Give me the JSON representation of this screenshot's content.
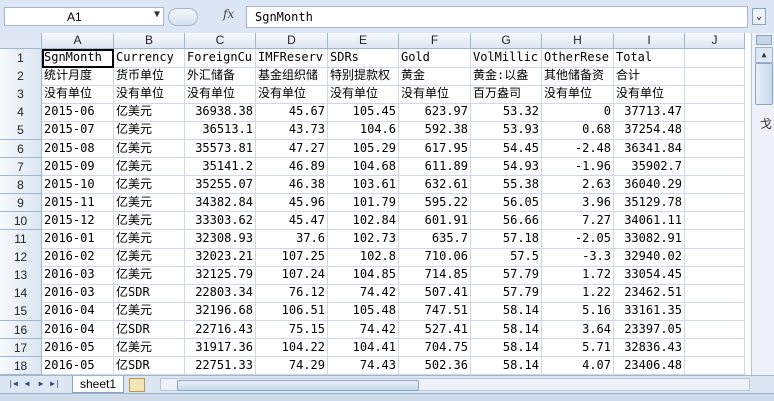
{
  "formula_bar": {
    "name_box": "A1",
    "fx_label": "fx",
    "formula_value": "SgnMonth"
  },
  "columns": [
    "A",
    "B",
    "C",
    "D",
    "E",
    "F",
    "G",
    "H",
    "I",
    "J"
  ],
  "rows": [
    [
      "SgnMonth",
      "Currency",
      "ForeignCu",
      "IMFReserv",
      "SDRs",
      "Gold",
      "VolMillic",
      "OtherRese",
      "Total",
      ""
    ],
    [
      "统计月度",
      "货币单位",
      "外汇储备",
      "基金组织储",
      "特别提款权",
      "黄金",
      "黄金:以盎",
      "其他储备资",
      "合计",
      ""
    ],
    [
      "没有单位",
      "没有单位",
      "没有单位",
      "没有单位",
      "没有单位",
      "没有单位",
      "百万盎司",
      "没有单位",
      "没有单位",
      ""
    ],
    [
      "2015-06",
      "亿美元",
      "36938.38",
      "45.67",
      "105.45",
      "623.97",
      "53.32",
      "0",
      "37713.47",
      ""
    ],
    [
      "2015-07",
      "亿美元",
      "36513.1",
      "43.73",
      "104.6",
      "592.38",
      "53.93",
      "0.68",
      "37254.48",
      ""
    ],
    [
      "2015-08",
      "亿美元",
      "35573.81",
      "47.27",
      "105.29",
      "617.95",
      "54.45",
      "-2.48",
      "36341.84",
      ""
    ],
    [
      "2015-09",
      "亿美元",
      "35141.2",
      "46.89",
      "104.68",
      "611.89",
      "54.93",
      "-1.96",
      "35902.7",
      ""
    ],
    [
      "2015-10",
      "亿美元",
      "35255.07",
      "46.38",
      "103.61",
      "632.61",
      "55.38",
      "2.63",
      "36040.29",
      ""
    ],
    [
      "2015-11",
      "亿美元",
      "34382.84",
      "45.96",
      "101.79",
      "595.22",
      "56.05",
      "3.96",
      "35129.78",
      ""
    ],
    [
      "2015-12",
      "亿美元",
      "33303.62",
      "45.47",
      "102.84",
      "601.91",
      "56.66",
      "7.27",
      "34061.11",
      ""
    ],
    [
      "2016-01",
      "亿美元",
      "32308.93",
      "37.6",
      "102.73",
      "635.7",
      "57.18",
      "-2.05",
      "33082.91",
      ""
    ],
    [
      "2016-02",
      "亿美元",
      "32023.21",
      "107.25",
      "102.8",
      "710.06",
      "57.5",
      "-3.3",
      "32940.02",
      ""
    ],
    [
      "2016-03",
      "亿美元",
      "32125.79",
      "107.24",
      "104.85",
      "714.85",
      "57.79",
      "1.72",
      "33054.45",
      ""
    ],
    [
      "2016-03",
      "亿SDR",
      "22803.34",
      "76.12",
      "74.42",
      "507.41",
      "57.79",
      "1.22",
      "23462.51",
      ""
    ],
    [
      "2016-04",
      "亿美元",
      "32196.68",
      "106.51",
      "105.48",
      "747.51",
      "58.14",
      "5.16",
      "33161.35",
      ""
    ],
    [
      "2016-04",
      "亿SDR",
      "22716.43",
      "75.15",
      "74.42",
      "527.41",
      "58.14",
      "3.64",
      "23397.05",
      ""
    ],
    [
      "2016-05",
      "亿美元",
      "31917.36",
      "104.22",
      "104.41",
      "704.75",
      "58.14",
      "5.71",
      "32836.43",
      ""
    ],
    [
      "2016-05",
      "亿SDR",
      "22751.33",
      "74.29",
      "74.43",
      "502.36",
      "58.14",
      "4.07",
      "23406.48",
      ""
    ]
  ],
  "row_numbers": [
    "1",
    "2",
    "3",
    "4",
    "5",
    "6",
    "7",
    "8",
    "9",
    "10",
    "11",
    "12",
    "13",
    "14",
    "15",
    "16",
    "17",
    "18"
  ],
  "sheet_tabs": [
    "sheet1"
  ],
  "offscreen_fragment": "戈"
}
